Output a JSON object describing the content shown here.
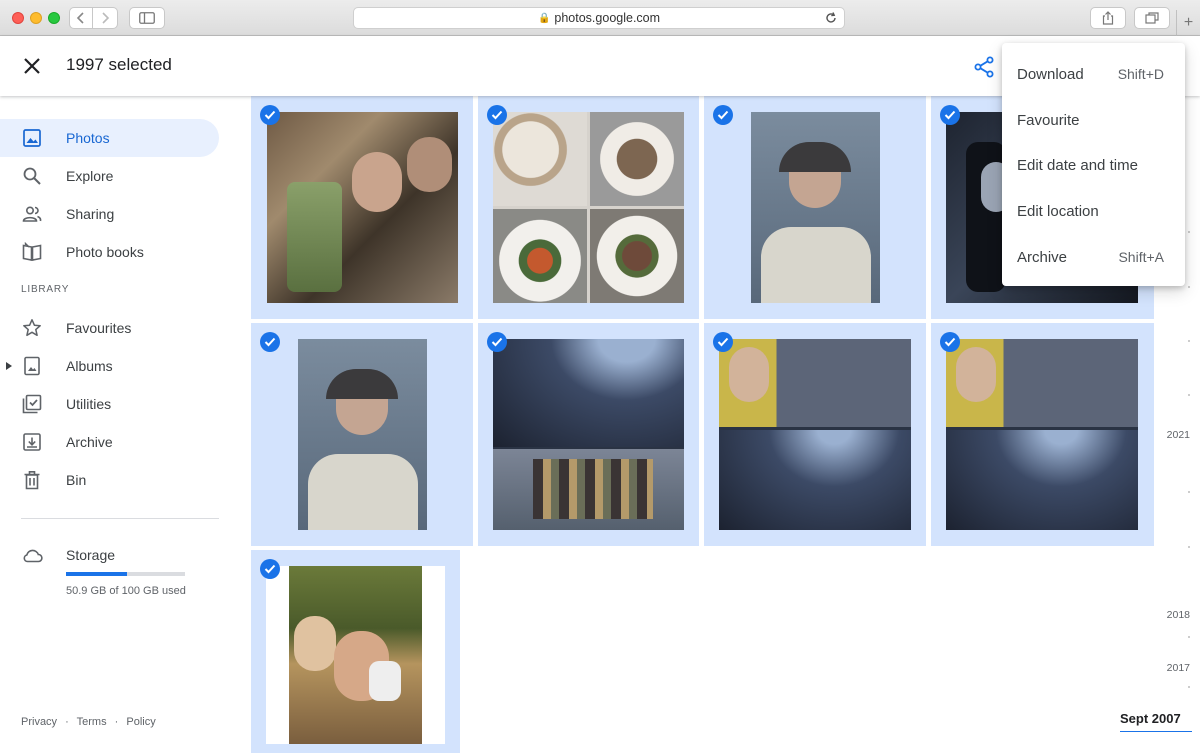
{
  "browser": {
    "url": "photos.google.com"
  },
  "topbar": {
    "selected_label": "1997 selected"
  },
  "sidebar": {
    "items": [
      {
        "label": "Photos",
        "icon": "photo-icon",
        "active": true
      },
      {
        "label": "Explore",
        "icon": "search-icon"
      },
      {
        "label": "Sharing",
        "icon": "people-icon"
      },
      {
        "label": "Photo books",
        "icon": "book-icon"
      }
    ],
    "library_header": "LIBRARY",
    "library_items": [
      {
        "label": "Favourites",
        "icon": "star-icon"
      },
      {
        "label": "Albums",
        "icon": "album-icon"
      },
      {
        "label": "Utilities",
        "icon": "utilities-icon"
      },
      {
        "label": "Archive",
        "icon": "archive-icon"
      },
      {
        "label": "Bin",
        "icon": "trash-icon"
      }
    ],
    "storage": {
      "title": "Storage",
      "used_text": "50.9 GB of 100 GB used",
      "fraction_used": 0.509
    },
    "footer": [
      "Privacy",
      "·",
      "Terms",
      "·",
      "Policy"
    ]
  },
  "menu": {
    "items": [
      {
        "label": "Download",
        "shortcut": "Shift+D"
      },
      {
        "label": "Favourite",
        "shortcut": ""
      },
      {
        "label": "Edit date and time",
        "shortcut": ""
      },
      {
        "label": "Edit location",
        "shortcut": ""
      },
      {
        "label": "Archive",
        "shortcut": "Shift+A"
      }
    ]
  },
  "timeline": {
    "years": [
      "2021",
      "2018",
      "2017"
    ],
    "current": "Sept 2007"
  },
  "colors": {
    "accent": "#1a73e8",
    "selection_bg": "#d3e3fd",
    "active_nav_bg": "#e8f0fe"
  }
}
